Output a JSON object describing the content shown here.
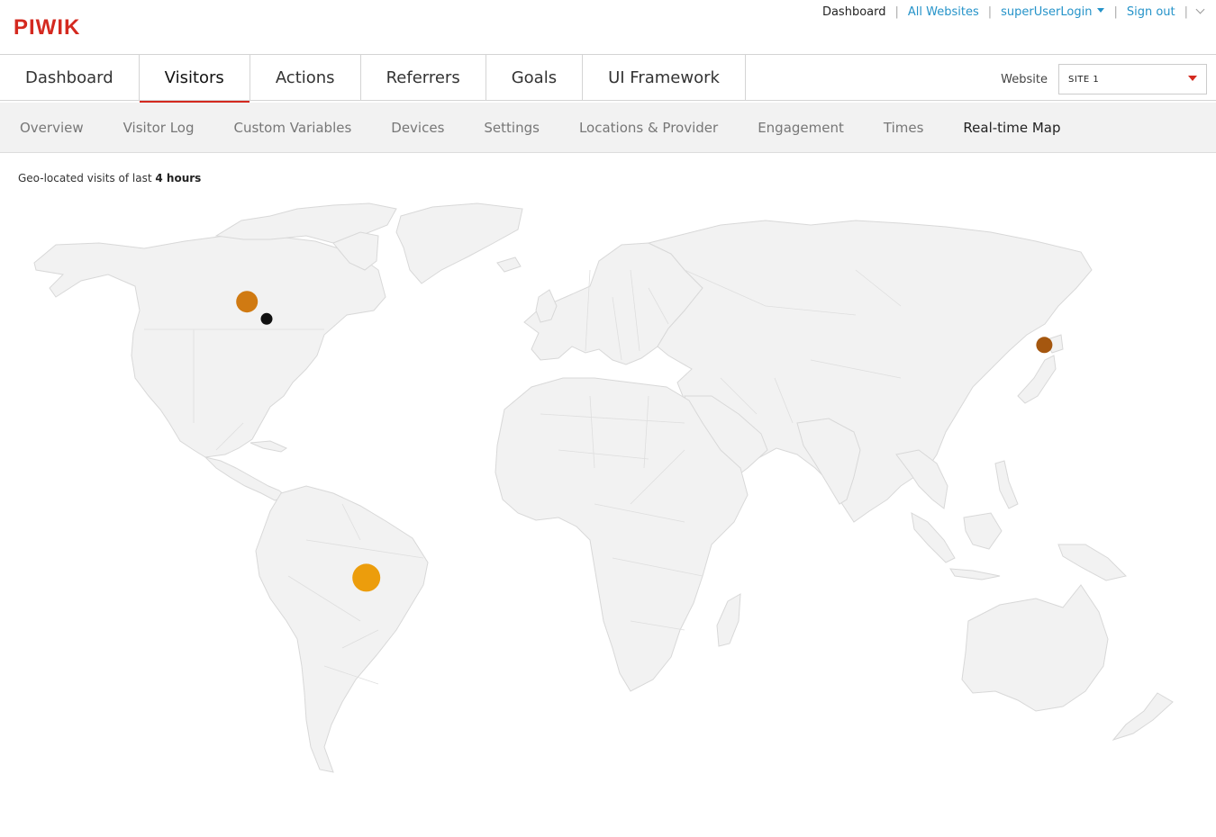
{
  "header": {
    "logo_text": "PIWIK",
    "links": [
      {
        "label": "Dashboard",
        "current": true
      },
      {
        "label": "All Websites",
        "current": false
      },
      {
        "label": "superUserLogin",
        "current": false
      },
      {
        "label": "Sign out",
        "current": false
      }
    ]
  },
  "main_nav": {
    "items": [
      {
        "label": "Dashboard"
      },
      {
        "label": "Visitors",
        "active": true
      },
      {
        "label": "Actions"
      },
      {
        "label": "Referrers"
      },
      {
        "label": "Goals"
      },
      {
        "label": "UI Framework"
      }
    ],
    "website_label": "Website",
    "site_value": "SITE 1"
  },
  "sub_nav": {
    "items": [
      {
        "label": "Overview"
      },
      {
        "label": "Visitor Log"
      },
      {
        "label": "Custom Variables"
      },
      {
        "label": "Devices"
      },
      {
        "label": "Settings"
      },
      {
        "label": "Locations & Provider"
      },
      {
        "label": "Engagement"
      },
      {
        "label": "Times"
      },
      {
        "label": "Real-time Map",
        "active": true
      }
    ]
  },
  "map": {
    "caption_prefix": "Geo-located visits of last",
    "caption_period": "4 hours",
    "visits": [
      {
        "name": "visit-toronto",
        "lon": -79.4,
        "lat": 43.7,
        "color": "#d07a12",
        "size": "large"
      },
      {
        "name": "visit-new-york",
        "lon": -74.0,
        "lat": 40.7,
        "color": "#111111",
        "size": "small"
      },
      {
        "name": "visit-tokyo",
        "lon": 139.7,
        "lat": 35.7,
        "color": "#a5570f",
        "size": "medium"
      },
      {
        "name": "visit-sao-paulo",
        "lon": -46.6,
        "lat": -23.5,
        "color": "#ec9d0c",
        "size": "xlarge"
      }
    ]
  }
}
